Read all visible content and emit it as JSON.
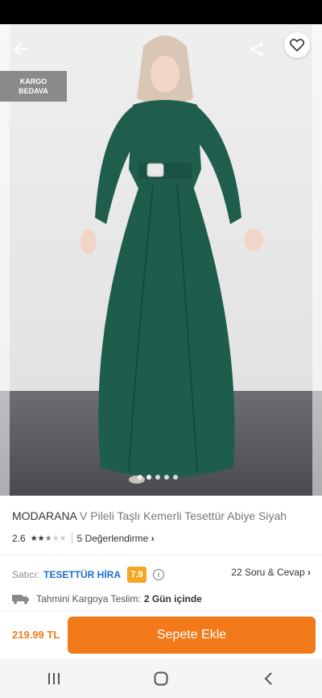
{
  "hero": {
    "back_icon": "arrow-left-icon",
    "share_icon": "share-icon",
    "favorite_icon": "heart-icon",
    "cargo_badge": {
      "line1": "KARGO",
      "line2": "BEDAVA"
    },
    "carousel": {
      "count": 5,
      "active_index": 1
    }
  },
  "product": {
    "brand": "MODARANA",
    "title": "V Pileli Taşlı Kemerli Tesettür Abiye Siyah",
    "rating": "2.6",
    "stars_filled": 2.6,
    "stars_total": 5,
    "reviews_label": "5 Değerlendirme"
  },
  "seller": {
    "label": "Satıcı:",
    "name": "TESETTÜR HİRA",
    "score": "7.9",
    "qa_label": "22 Soru & Cevap"
  },
  "delivery": {
    "icon": "truck-icon",
    "label": "Tahmini Kargoya Teslim:",
    "value": "2 Gün içinde"
  },
  "bottom": {
    "price": "219.99 TL",
    "add_to_cart": "Sepete Ekle"
  },
  "colors": {
    "accent": "#f27a1a",
    "seller_link": "#1e6fcf",
    "score_badge": "#f5a623"
  },
  "navbar": [
    "recent-apps-icon",
    "home-icon",
    "back-icon"
  ]
}
